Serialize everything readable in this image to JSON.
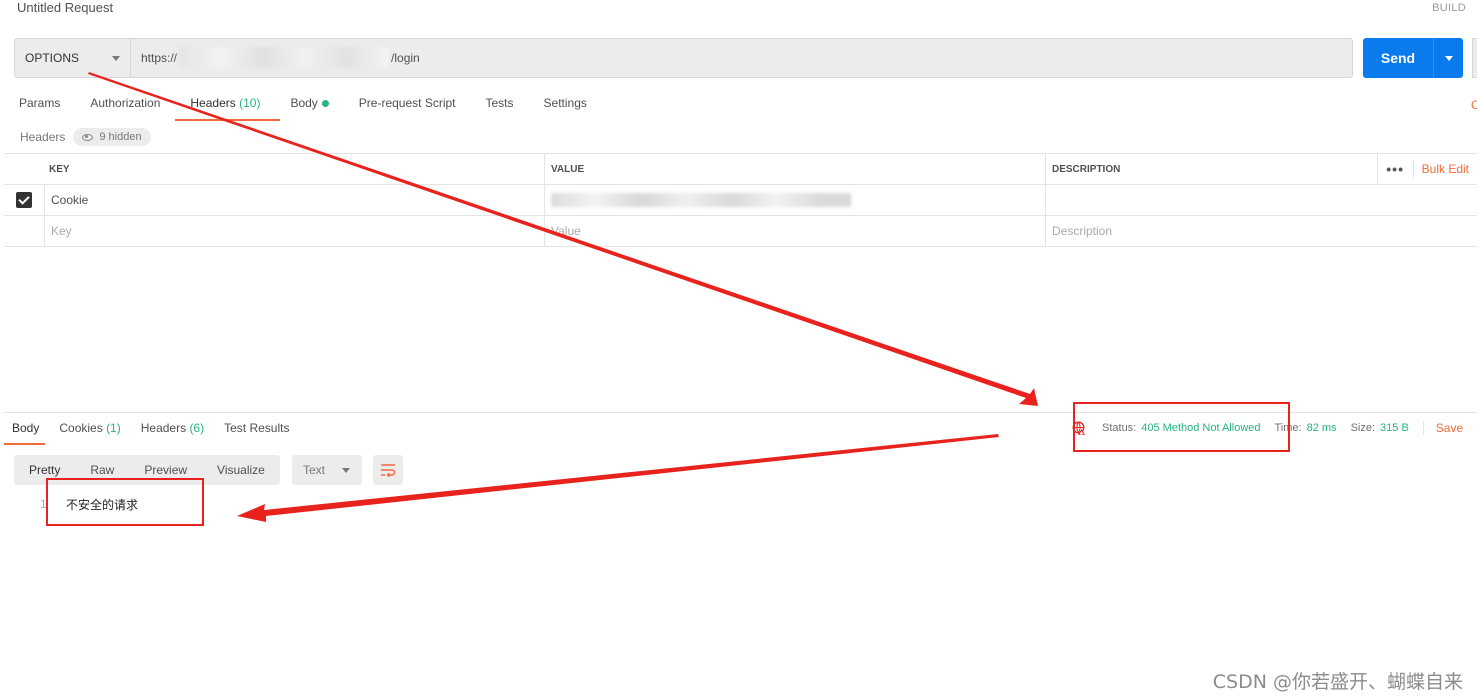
{
  "request": {
    "title": "Untitled Request",
    "build_label": "BUILD",
    "method": "OPTIONS",
    "url_prefix": "https://",
    "url_suffix": "/login",
    "send_label": "Send",
    "tabs": [
      {
        "label": "Params"
      },
      {
        "label": "Authorization"
      },
      {
        "label": "Headers",
        "count": "(10)"
      },
      {
        "label": "Body"
      },
      {
        "label": "Pre-request Script"
      },
      {
        "label": "Tests"
      },
      {
        "label": "Settings"
      }
    ],
    "cookies_link": "C"
  },
  "headers": {
    "label": "Headers",
    "hidden_count": "9 hidden",
    "columns": {
      "key": "KEY",
      "value": "VALUE",
      "description": "DESCRIPTION"
    },
    "more_label": "•••",
    "bulk_edit": "Bulk Edit",
    "rows": [
      {
        "key": "Cookie",
        "enabled": true
      }
    ],
    "placeholders": {
      "key": "Key",
      "value": "Value",
      "description": "Description"
    }
  },
  "response": {
    "tabs": [
      {
        "label": "Body"
      },
      {
        "label": "Cookies",
        "count": "(1)"
      },
      {
        "label": "Headers",
        "count": "(6)"
      },
      {
        "label": "Test Results"
      }
    ],
    "status_label": "Status:",
    "status_value": "405 Method Not Allowed",
    "time_label": "Time:",
    "time_value": "82 ms",
    "size_label": "Size:",
    "size_value": "315 B",
    "save_label": "Save",
    "view_options": [
      "Pretty",
      "Raw",
      "Preview",
      "Visualize"
    ],
    "format": "Text",
    "line_number": "1",
    "body_text": "不安全的请求"
  },
  "colors": {
    "accent": "#f26b3a",
    "send_blue": "#097bed",
    "status_green": "#26b47f",
    "annotation_red": "#e8231d"
  },
  "watermark": "CSDN @你若盛开、蝴蝶自来"
}
